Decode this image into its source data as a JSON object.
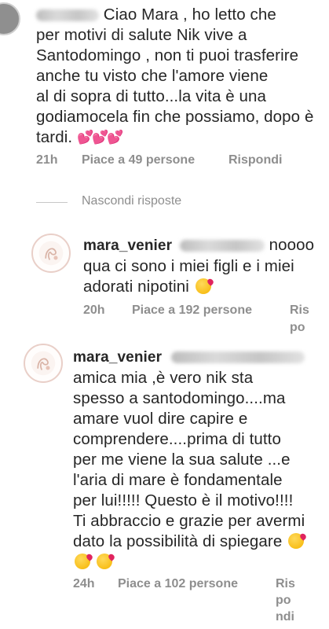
{
  "comment1": {
    "text_line1": "Ciao Mara , ho letto che",
    "text_line2": "per motivi di salute Nik vive a",
    "text_line3": "Santodomingo , non ti puoi trasferire",
    "text_line4": "anche tu visto che l'amore viene",
    "text_line5": "al di sopra di tutto...la vita è una",
    "text_line6": "godiamocela fin che possiamo, dopo è",
    "text_line7": "tardi.",
    "hearts": "💕💕💕",
    "time": "21h",
    "likes": "Piace a 49 persone",
    "reply": "Rispondi"
  },
  "hide_replies": "Nascondi risposte",
  "reply1": {
    "username": "mara_venier",
    "text_tail": "noooo",
    "text_line2": "qua ci sono i miei figli e i miei",
    "text_line3": "adorati nipotini",
    "time": "20h",
    "likes": "Piace a 192 persone",
    "reply_1": "Ris",
    "reply_2": "po"
  },
  "reply2": {
    "username": "mara_venier",
    "lines": [
      "amica mia ,è vero nik sta",
      "spesso a santodomingo....ma",
      "amare vuol dire capire e",
      "comprendere....prima di tutto",
      "per me viene la sua salute ...e",
      "l'aria di mare è fondamentale",
      "per lui!!!!! Questo è il motivo!!!!",
      "Ti abbraccio e grazie per avermi",
      "dato la possibilità di spiegare"
    ],
    "time": "24h",
    "likes": "Piace a 102 persone",
    "reply_1": "Ris",
    "reply_2": "po",
    "reply_3": "ndi"
  },
  "colors": {
    "text": "#262626",
    "meta": "#8e8e8e",
    "heart": "#e0409a"
  },
  "icons": [
    "avatar-icon",
    "blushing-kiss-emoji-icon",
    "pink-hearts-icon"
  ]
}
